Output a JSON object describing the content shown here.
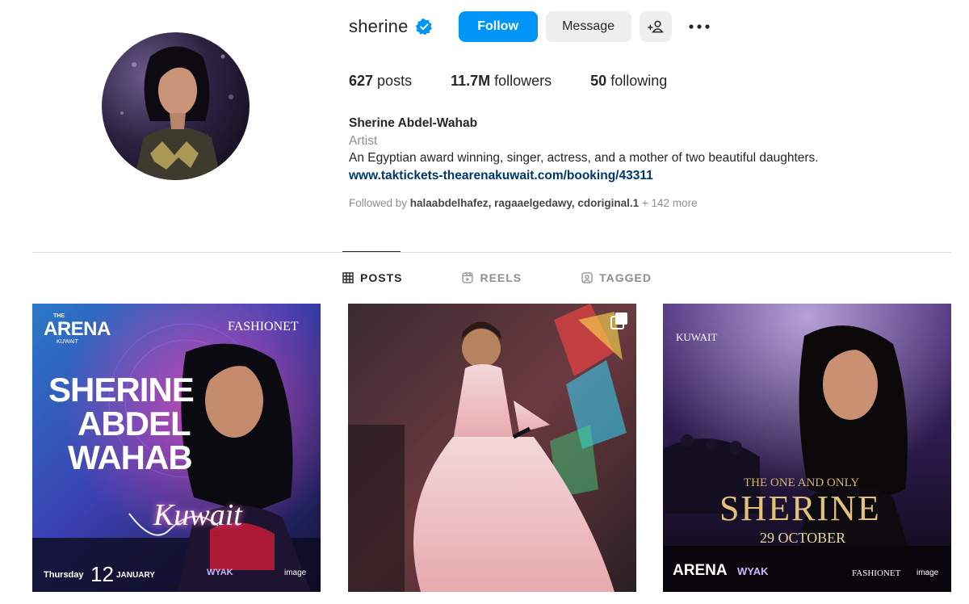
{
  "profile": {
    "username": "sherine",
    "verified": true,
    "follow_label": "Follow",
    "message_label": "Message",
    "stats": {
      "posts": "627",
      "posts_label": " posts",
      "followers": "11.7M",
      "followers_label": " followers",
      "following": "50",
      "following_label": " following"
    },
    "bio": {
      "name": "Sherine Abdel-Wahab",
      "category": "Artist",
      "description": "An Egyptian award winning, singer, actress, and a mother of two beautiful daughters.",
      "link": "www.taktickets-thearenakuwait.com/booking/43311"
    },
    "followed_by": {
      "prefix": "Followed by ",
      "users": "halaabdelhafez, ragaaelgedawy, cdoriginal.1",
      "suffix": " + 142 more"
    }
  },
  "tabs": [
    {
      "label": "POSTS",
      "icon": "grid-icon",
      "active": true
    },
    {
      "label": "REELS",
      "icon": "reels-icon",
      "active": false
    },
    {
      "label": "TAGGED",
      "icon": "tagged-icon",
      "active": false
    }
  ],
  "posts": [
    {
      "arena": "ARENA",
      "the": "THE",
      "kuwait_small": "KUWAIT",
      "brand": "FASHIONET",
      "line1": "SHERINE",
      "line2": "ABDEL",
      "line3": "WAHAB",
      "script": "Kuwait",
      "day": "Thursday",
      "date": "12",
      "month": "JANUARY",
      "sponsor1": "WYAK",
      "sponsor2": "image"
    },
    {
      "multi_icon": "carousel-icon"
    },
    {
      "kuwait": "KUWAIT",
      "tagline": "THE ONE AND ONLY",
      "name": "SHERINE",
      "date": "29 OCTOBER",
      "arena": "ARENA",
      "sponsor1": "WYAK",
      "brand": "FASHIONET",
      "sponsor2": "image"
    }
  ],
  "colors": {
    "accent": "#0095f6",
    "link": "#00376b",
    "muted": "#8e8e8e"
  }
}
